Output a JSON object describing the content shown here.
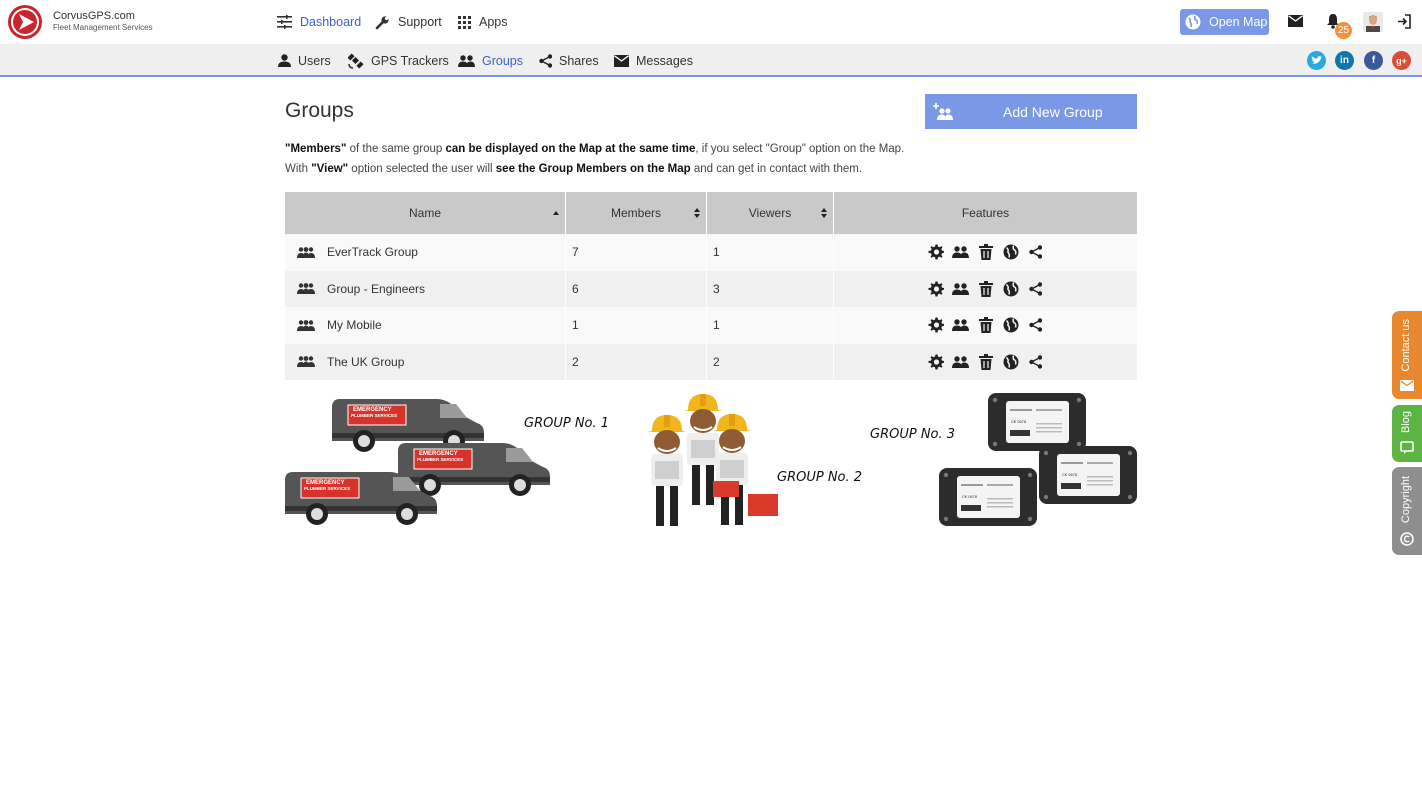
{
  "brand": {
    "name": "CorvusGPS.com",
    "tagline": "Fleet Management Services"
  },
  "topnav": [
    {
      "label": "Dashboard",
      "icon": "sliders-icon",
      "active": true
    },
    {
      "label": "Support",
      "icon": "wrench-icon",
      "active": false
    },
    {
      "label": "Apps",
      "icon": "grid-icon",
      "active": false
    }
  ],
  "header_actions": {
    "open_map_label": "Open Map",
    "notification_count": "25"
  },
  "subnav": [
    {
      "label": "Users",
      "icon": "person-icon",
      "active": false
    },
    {
      "label": "GPS Trackers",
      "icon": "satellite-icon",
      "active": false
    },
    {
      "label": "Groups",
      "icon": "people-icon",
      "active": true
    },
    {
      "label": "Shares",
      "icon": "share-icon",
      "active": false
    },
    {
      "label": "Messages",
      "icon": "envelope-icon",
      "active": false
    }
  ],
  "social": [
    "twitter-icon",
    "linkedin-icon",
    "facebook-icon",
    "google-plus-icon"
  ],
  "page": {
    "title": "Groups",
    "add_button_label": "Add New Group",
    "desc1": {
      "p1": "\"Members\"",
      "p2": " of the same group ",
      "p3": "can be displayed on the Map at the same time",
      "p4": ", if you select \"Group\" option on the Map."
    },
    "desc2": {
      "p1": "With ",
      "p2": "\"View\"",
      "p3": " option selected the user will ",
      "p4": "see the Group Members on the Map",
      "p5": " and can get in contact with them."
    }
  },
  "table": {
    "headers": [
      "Name",
      "Members",
      "Viewers",
      "Features"
    ],
    "rows": [
      {
        "name": "EverTrack Group",
        "members": "7",
        "viewers": "1"
      },
      {
        "name": "Group - Engineers",
        "members": "6",
        "viewers": "3"
      },
      {
        "name": "My Mobile",
        "members": "1",
        "viewers": "1"
      },
      {
        "name": "The UK Group",
        "members": "2",
        "viewers": "2"
      }
    ],
    "feature_icons": [
      "gear-icon",
      "people-icon",
      "trash-icon",
      "globe-icon",
      "share-icon"
    ]
  },
  "illustration": {
    "group1_label": "GROUP No. 1",
    "group2_label": "GROUP No. 2",
    "group3_label": "GROUP No. 3",
    "van_sign_line1": "EMERGENCY",
    "van_sign_line2": "PLUMBER SERVICES",
    "device_mark": "C€ 0678"
  },
  "side_tabs": [
    {
      "label": "Contact us",
      "color": "#e8882e"
    },
    {
      "label": "Blog",
      "color": "#5cb543"
    },
    {
      "label": "Copyright",
      "color": "#8e8e8e"
    }
  ]
}
